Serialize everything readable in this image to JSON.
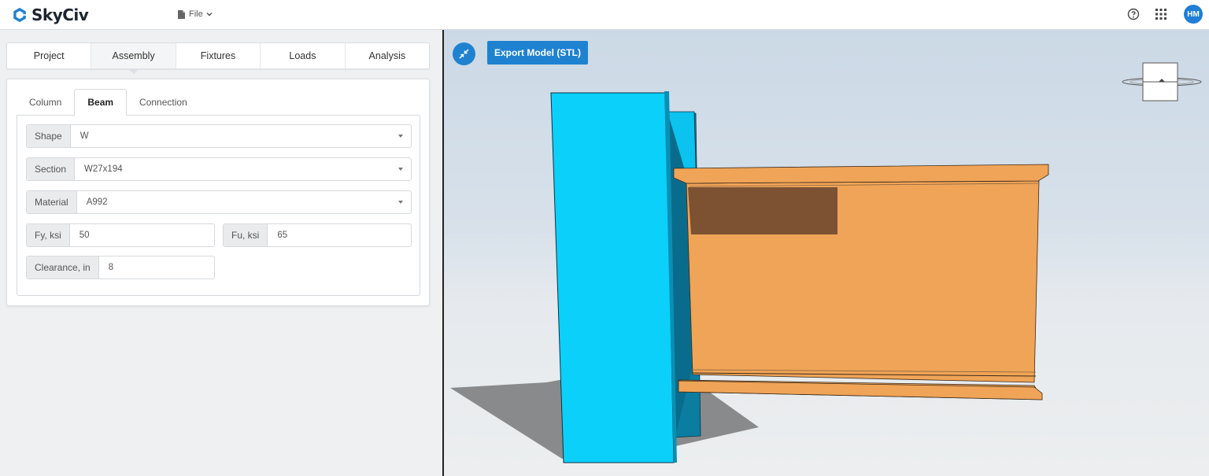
{
  "app": {
    "logo_text": "SkyCiv",
    "logo_icon": "skyciv-logo-icon"
  },
  "header": {
    "file_label": "File",
    "file_icon": "file-icon",
    "help_icon": "help-icon",
    "apps_icon": "apps-grid-icon",
    "avatar_initials": "HM",
    "avatar_color": "#1f7ed6"
  },
  "main_tabs": [
    {
      "label": "Project"
    },
    {
      "label": "Assembly",
      "active": true
    },
    {
      "label": "Fixtures"
    },
    {
      "label": "Loads"
    },
    {
      "label": "Analysis"
    }
  ],
  "sub_tabs": [
    {
      "label": "Column"
    },
    {
      "label": "Beam",
      "active": true
    },
    {
      "label": "Connection"
    }
  ],
  "form": {
    "shape": {
      "label": "Shape",
      "value": "W"
    },
    "section": {
      "label": "Section",
      "value": "W27x194"
    },
    "material": {
      "label": "Material",
      "value": "A992"
    },
    "fy": {
      "label": "Fy, ksi",
      "value": "50"
    },
    "fu": {
      "label": "Fu, ksi",
      "value": "65"
    },
    "clearance": {
      "label": "Clearance, in",
      "value": "8"
    }
  },
  "viewport": {
    "export_label": "Export Model (STL)",
    "collapse_icon": "collapse-arrows-icon",
    "accent_color": "#1f82d0",
    "column_color": "#0bd0fa",
    "beam_color": "#f0a457"
  }
}
